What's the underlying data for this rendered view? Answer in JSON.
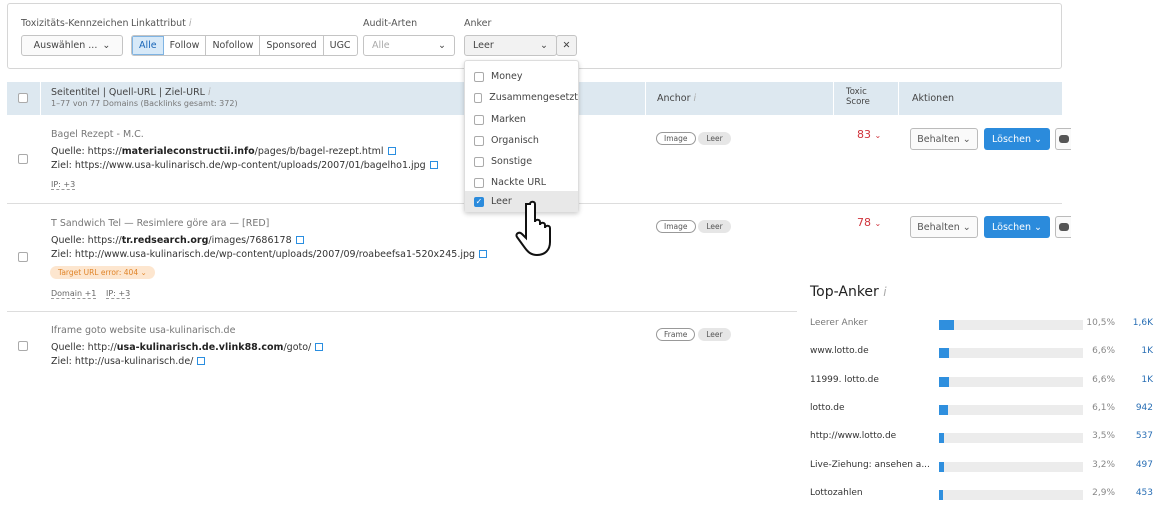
{
  "filters": {
    "toxicity": {
      "label": "Toxizitäts-Kennzeichen",
      "value": "Auswählen ..."
    },
    "linkattr": {
      "label": "Linkattribut",
      "options": [
        "Alle",
        "Follow",
        "Nofollow",
        "Sponsored",
        "UGC"
      ],
      "selected": "Alle"
    },
    "audit": {
      "label": "Audit-Arten",
      "placeholder": "Alle"
    },
    "anchor": {
      "label": "Anker",
      "value": "Leer",
      "options": [
        {
          "label": "Money",
          "checked": false
        },
        {
          "label": "Zusammengesetzt",
          "checked": false
        },
        {
          "label": "Marken",
          "checked": false
        },
        {
          "label": "Organisch",
          "checked": false
        },
        {
          "label": "Sonstige",
          "checked": false
        },
        {
          "label": "Nackte URL",
          "checked": false
        },
        {
          "label": "Leer",
          "checked": true
        }
      ]
    }
  },
  "table": {
    "headers": {
      "title": "Seitentitel | Quell-URL | Ziel-URL",
      "subtitle": "1–77 von 77 Domains (Backlinks gesamt: 372)",
      "anchor": "Anchor",
      "toxic1": "Toxic",
      "toxic2": "Score",
      "actions": "Aktionen"
    },
    "keep_label": "Behalten",
    "delete_label": "Löschen",
    "rows": [
      {
        "title": "Bagel Rezept - M.C.",
        "src_prefix": "Quelle: https://",
        "src_bold": "materialeconstructii.info",
        "src_rest": "/pages/b/bagel-rezept.html",
        "target": "Ziel: https://www.usa-kulinarisch.de/wp-content/uploads/2007/01/bagelho1.jpg",
        "ip": "IP: +3",
        "tags": [
          "Image",
          "Leer"
        ],
        "score": "83"
      },
      {
        "title": "T Sandwich Tel — Resimlere göre ara — [RED]",
        "src_prefix": "Quelle: https://",
        "src_bold": "tr.redsearch.org",
        "src_rest": "/images/7686178",
        "target": "Ziel: http://www.usa-kulinarisch.de/wp-content/uploads/2007/09/roabeefsa1-520x245.jpg",
        "error": "Target URL error: 404",
        "domain": "Domain +1",
        "ip": "IP: +3",
        "tags": [
          "Image",
          "Leer"
        ],
        "score": "78"
      },
      {
        "title": "Iframe goto website usa-kulinarisch.de",
        "src_prefix": "Quelle: http://",
        "src_bold": "usa-kulinarisch.de.vlink88.com",
        "src_rest": "/goto/",
        "target": "Ziel: http://usa-kulinarisch.de/",
        "tags": [
          "Frame",
          "Leer"
        ]
      }
    ]
  },
  "top_anchors": {
    "title": "Top-Anker",
    "items": [
      {
        "label": "Leerer Anker",
        "pct": "10,5%",
        "pct_value": 10.5,
        "count": "1,6K"
      },
      {
        "label": "www.lotto.de",
        "pct": "6,6%",
        "pct_value": 6.6,
        "count": "1K"
      },
      {
        "label": "11999. lotto.de",
        "pct": "6,6%",
        "pct_value": 6.6,
        "count": "1K"
      },
      {
        "label": "lotto.de",
        "pct": "6,1%",
        "pct_value": 6.1,
        "count": "942"
      },
      {
        "label": "http://www.lotto.de",
        "pct": "3,5%",
        "pct_value": 3.5,
        "count": "537"
      },
      {
        "label": "Live-Ziehung: ansehen a...",
        "pct": "3,2%",
        "pct_value": 3.2,
        "count": "497"
      },
      {
        "label": "Lottozahlen",
        "pct": "2,9%",
        "pct_value": 2.9,
        "count": "453"
      }
    ]
  },
  "colors": {
    "accent": "#2b8bdc",
    "score": "#d0333b",
    "header_bg": "#dde8f0"
  }
}
